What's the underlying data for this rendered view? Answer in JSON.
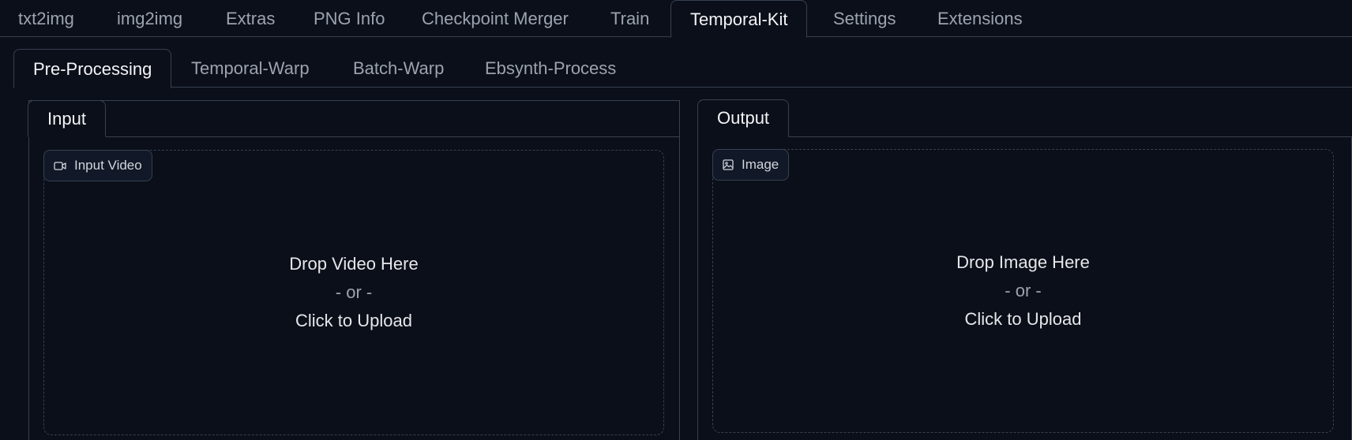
{
  "main_tabs": [
    {
      "label": "txt2img"
    },
    {
      "label": "img2img"
    },
    {
      "label": "Extras"
    },
    {
      "label": "PNG Info"
    },
    {
      "label": "Checkpoint Merger"
    },
    {
      "label": "Train"
    },
    {
      "label": "Temporal-Kit"
    },
    {
      "label": "Settings"
    },
    {
      "label": "Extensions"
    }
  ],
  "active_main_tab": "Temporal-Kit",
  "sub_tabs": [
    {
      "label": "Pre-Processing"
    },
    {
      "label": "Temporal-Warp"
    },
    {
      "label": "Batch-Warp"
    },
    {
      "label": "Ebsynth-Process"
    }
  ],
  "active_sub_tab": "Pre-Processing",
  "input_panel": {
    "tab_label": "Input",
    "dropzone": {
      "label": "Input Video",
      "icon": "video-camera-icon",
      "line1": "Drop Video Here",
      "line2": "- or -",
      "line3": "Click to Upload"
    }
  },
  "output_panel": {
    "tab_label": "Output",
    "dropzone": {
      "label": "Image",
      "icon": "image-icon",
      "line1": "Drop Image Here",
      "line2": "- or -",
      "line3": "Click to Upload"
    }
  },
  "colors": {
    "background": "#0b0f19",
    "border": "#374151",
    "text": "#e5e7eb",
    "muted_text": "#9ca3af"
  }
}
